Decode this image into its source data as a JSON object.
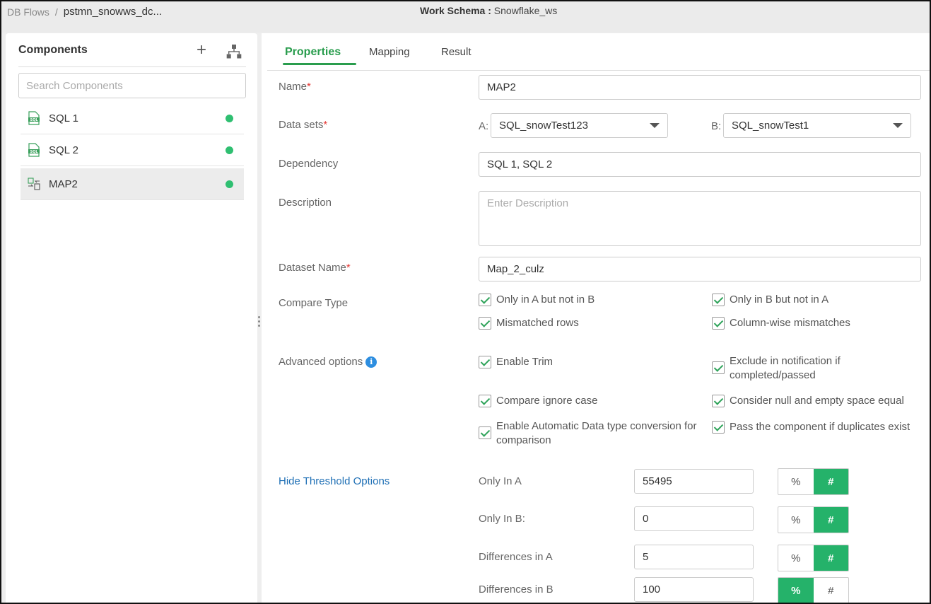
{
  "topbar": {
    "breadcrumb_root": "DB Flows",
    "breadcrumb_sep": "/",
    "breadcrumb_current": "pstmn_snowws_dc...",
    "schema_label": "Work Schema :",
    "schema_value": "Snowflake_ws"
  },
  "sidebar": {
    "title": "Components",
    "search_placeholder": "Search Components",
    "items": [
      {
        "label": "SQL 1",
        "icon": "sql-file-icon",
        "status_color": "#2fbf71"
      },
      {
        "label": "SQL 2",
        "icon": "sql-file-icon",
        "status_color": "#2fbf71"
      },
      {
        "label": "MAP2",
        "icon": "map-compare-icon",
        "status_color": "#2fbf71"
      }
    ]
  },
  "tabs": [
    {
      "label": "Properties",
      "active": true
    },
    {
      "label": "Mapping",
      "active": false
    },
    {
      "label": "Result",
      "active": false
    }
  ],
  "form": {
    "name_label": "Name",
    "name_value": "MAP2",
    "datasets_label": "Data sets",
    "dataset_a_prefix": "A:",
    "dataset_a_value": "SQL_snowTest123",
    "dataset_b_prefix": "B:",
    "dataset_b_value": "SQL_snowTest1",
    "dependency_label": "Dependency",
    "dependency_value": "SQL 1, SQL 2",
    "description_label": "Description",
    "description_placeholder": "Enter Description",
    "dataset_name_label": "Dataset Name",
    "dataset_name_value": "Map_2_culz",
    "required_mark": "*",
    "compare_type_label": "Compare Type",
    "compare_type": [
      "Only in A but not in B",
      "Only in B but not in A",
      "Mismatched rows",
      "Column-wise mismatches"
    ],
    "advanced_label": "Advanced options",
    "info_glyph": "i",
    "advanced": [
      "Enable Trim",
      "Exclude in notification if completed/passed",
      "Compare ignore case",
      "Consider null and empty space equal",
      "Enable Automatic Data type conversion for comparison",
      "Pass the component if duplicates exist"
    ],
    "threshold_link": "Hide Threshold Options",
    "percent_symbol": "%",
    "hash_symbol": "#",
    "thresholds": [
      {
        "label": "Only In A",
        "value": "55495",
        "mode": "#"
      },
      {
        "label": "Only In B:",
        "value": "0",
        "mode": "#"
      },
      {
        "label": "Differences in A",
        "value": "5",
        "mode": "#"
      },
      {
        "label": "Differences in B",
        "value": "100",
        "mode": "%"
      }
    ]
  },
  "colors": {
    "accent": "#2a9d4e",
    "toggle_on": "#25b26a",
    "link": "#1e6fb5",
    "required": "#e53935"
  }
}
